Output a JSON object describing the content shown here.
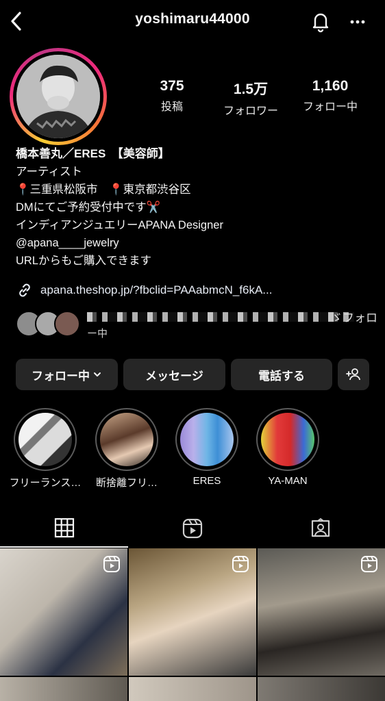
{
  "header": {
    "username": "yoshimaru44000",
    "back_icon": "chevron-left-icon",
    "bell_icon": "bell-icon",
    "more_icon": "more-horizontal-icon"
  },
  "stats": {
    "posts": {
      "value": "375",
      "label": "投稿"
    },
    "followers": {
      "value": "1.5万",
      "label": "フォロワー"
    },
    "following": {
      "value": "1,160",
      "label": "フォロー中"
    }
  },
  "bio": {
    "name_line": "橋本善丸／ERES　【美容師】",
    "category": "アーティスト",
    "location": "📍三重県松阪市　📍東京都渋谷区",
    "line1": "DMにてご予約受付中です✂️",
    "line2": "インディアンジュエリーAPANA Designer",
    "line3": "@apana____jewelry",
    "line4": "URLからもご購入できます",
    "link": "apana.theshop.jp/?fbclid=PAAabmcN_f6kA...",
    "mutual_tail": "ゞフォロ",
    "mutual_tail2": "ー中"
  },
  "buttons": {
    "following": "フォロー中",
    "message": "メッセージ",
    "call": "電話する"
  },
  "highlights": [
    {
      "label": "フリーランス…"
    },
    {
      "label": "断捨離フリ…"
    },
    {
      "label": "ERES"
    },
    {
      "label": "YA-MAN"
    }
  ],
  "tabs": [
    "grid-icon",
    "reels-icon",
    "tagged-icon"
  ],
  "colors": {
    "background": "#000000",
    "button_bg": "#262626",
    "ring_gradient": [
      "#f9ce34",
      "#ee2a7b",
      "#c13584"
    ]
  }
}
